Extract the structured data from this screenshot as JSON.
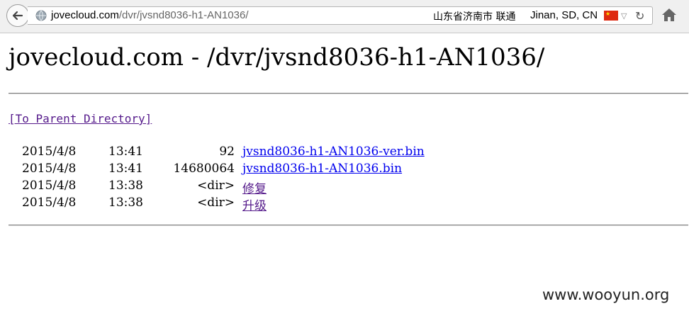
{
  "browser": {
    "url_host": "jovecloud.com",
    "url_path": "/dvr/jvsnd8036-h1-AN1036/",
    "geo_region": "山东省济南市 联通",
    "geo_location": "Jinan, SD, CN",
    "icons": [
      "back-arrow-icon",
      "globe-icon",
      "china-flag-icon",
      "dropdown-icon",
      "reload-icon",
      "home-icon"
    ]
  },
  "page": {
    "title": "jovecloud.com - /dvr/jvsnd8036-h1-AN1036/",
    "parent_link": "[To Parent Directory]",
    "entries": [
      {
        "date": "2015/4/8",
        "time": "13:41",
        "size": "92",
        "name": "jvsnd8036-h1-AN1036-ver.bin"
      },
      {
        "date": "2015/4/8",
        "time": "13:41",
        "size": "14680064",
        "name": "jvsnd8036-h1-AN1036.bin"
      },
      {
        "date": "2015/4/8",
        "time": "13:38",
        "size": "<dir>",
        "name": "修复"
      },
      {
        "date": "2015/4/8",
        "time": "13:38",
        "size": "<dir>",
        "name": "升级"
      }
    ]
  },
  "watermark": "www.wooyun.org",
  "colors": {
    "link": "#0000ee",
    "visited_link": "#551a8b",
    "flag_red": "#de2910"
  }
}
